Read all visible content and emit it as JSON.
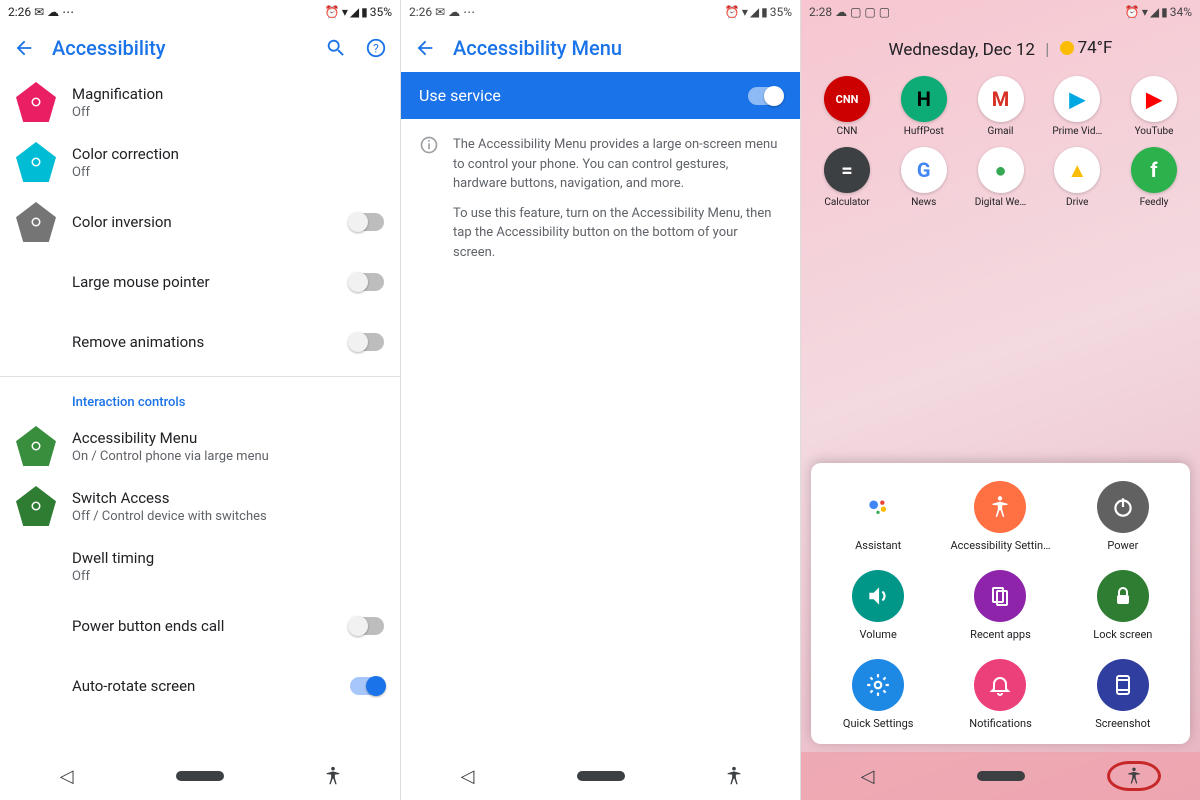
{
  "screen1": {
    "status": {
      "time": "2:26",
      "battery": "35%"
    },
    "title": "Accessibility",
    "items": [
      {
        "label": "Magnification",
        "sub": "Off",
        "icon": "magnify",
        "color": "#e91e63",
        "toggle": null
      },
      {
        "label": "Color correction",
        "sub": "Off",
        "icon": "eyedropper",
        "color": "#00bcd4",
        "toggle": null
      },
      {
        "label": "Color inversion",
        "sub": "",
        "icon": "contrast",
        "color": "#757575",
        "toggle": false
      },
      {
        "label": "Large mouse pointer",
        "sub": "",
        "icon": "",
        "color": "",
        "toggle": false
      },
      {
        "label": "Remove animations",
        "sub": "",
        "icon": "",
        "color": "",
        "toggle": false
      }
    ],
    "section": "Interaction controls",
    "items2": [
      {
        "label": "Accessibility Menu",
        "sub": "On / Control phone via large menu",
        "icon": "dots",
        "color": "#388e3c",
        "toggle": null
      },
      {
        "label": "Switch Access",
        "sub": "Off / Control device with switches",
        "icon": "switch",
        "color": "#2e7d32",
        "toggle": null
      },
      {
        "label": "Dwell timing",
        "sub": "Off",
        "icon": "",
        "color": "",
        "toggle": null
      },
      {
        "label": "Power button ends call",
        "sub": "",
        "icon": "",
        "color": "",
        "toggle": false
      },
      {
        "label": "Auto-rotate screen",
        "sub": "",
        "icon": "",
        "color": "",
        "toggle": true
      }
    ]
  },
  "screen2": {
    "status": {
      "time": "2:26",
      "battery": "35%"
    },
    "title": "Accessibility Menu",
    "service_label": "Use service",
    "service_on": true,
    "info1": "The Accessibility Menu provides a large on-screen menu to control your phone. You can control gestures, hardware buttons, navigation, and more.",
    "info2": "To use this feature, turn on the Accessibility Menu, then tap the Accessibility button on the bottom of your screen."
  },
  "screen3": {
    "status": {
      "time": "2:28",
      "battery": "34%"
    },
    "date": "Wednesday, Dec 12",
    "temp": "74°F",
    "apps_row1": [
      {
        "label": "CNN",
        "bg": "#cc0000",
        "txt": "CNN",
        "fg": "#fff"
      },
      {
        "label": "HuffPost",
        "bg": "#0dab76",
        "txt": "H",
        "fg": "#000"
      },
      {
        "label": "Gmail",
        "bg": "#ffffff",
        "txt": "M",
        "fg": "#d93025"
      },
      {
        "label": "Prime Vid…",
        "bg": "#ffffff",
        "txt": "▶",
        "fg": "#00a8e1"
      },
      {
        "label": "YouTube",
        "bg": "#ffffff",
        "txt": "▶",
        "fg": "#ff0000"
      }
    ],
    "apps_row2": [
      {
        "label": "Calculator",
        "bg": "#3c4043",
        "txt": "=",
        "fg": "#fff"
      },
      {
        "label": "News",
        "bg": "#ffffff",
        "txt": "G",
        "fg": "#4285f4"
      },
      {
        "label": "Digital We…",
        "bg": "#ffffff",
        "txt": "●",
        "fg": "#34a853"
      },
      {
        "label": "Drive",
        "bg": "#ffffff",
        "txt": "▲",
        "fg": "#fbbc04"
      },
      {
        "label": "Feedly",
        "bg": "#2bb24c",
        "txt": "f",
        "fg": "#fff"
      }
    ],
    "panel": [
      {
        "label": "Assistant",
        "bg": "#ffffff",
        "icon": "assistant"
      },
      {
        "label": "Accessibility Settin…",
        "bg": "#ff7043",
        "icon": "a11y"
      },
      {
        "label": "Power",
        "bg": "#616161",
        "icon": "power"
      },
      {
        "label": "Volume",
        "bg": "#009688",
        "icon": "volume"
      },
      {
        "label": "Recent apps",
        "bg": "#8e24aa",
        "icon": "recents"
      },
      {
        "label": "Lock screen",
        "bg": "#2e7d32",
        "icon": "lock"
      },
      {
        "label": "Quick Settings",
        "bg": "#1e88e5",
        "icon": "settings"
      },
      {
        "label": "Notifications",
        "bg": "#ec407a",
        "icon": "bell"
      },
      {
        "label": "Screenshot",
        "bg": "#303f9f",
        "icon": "screenshot"
      }
    ]
  }
}
